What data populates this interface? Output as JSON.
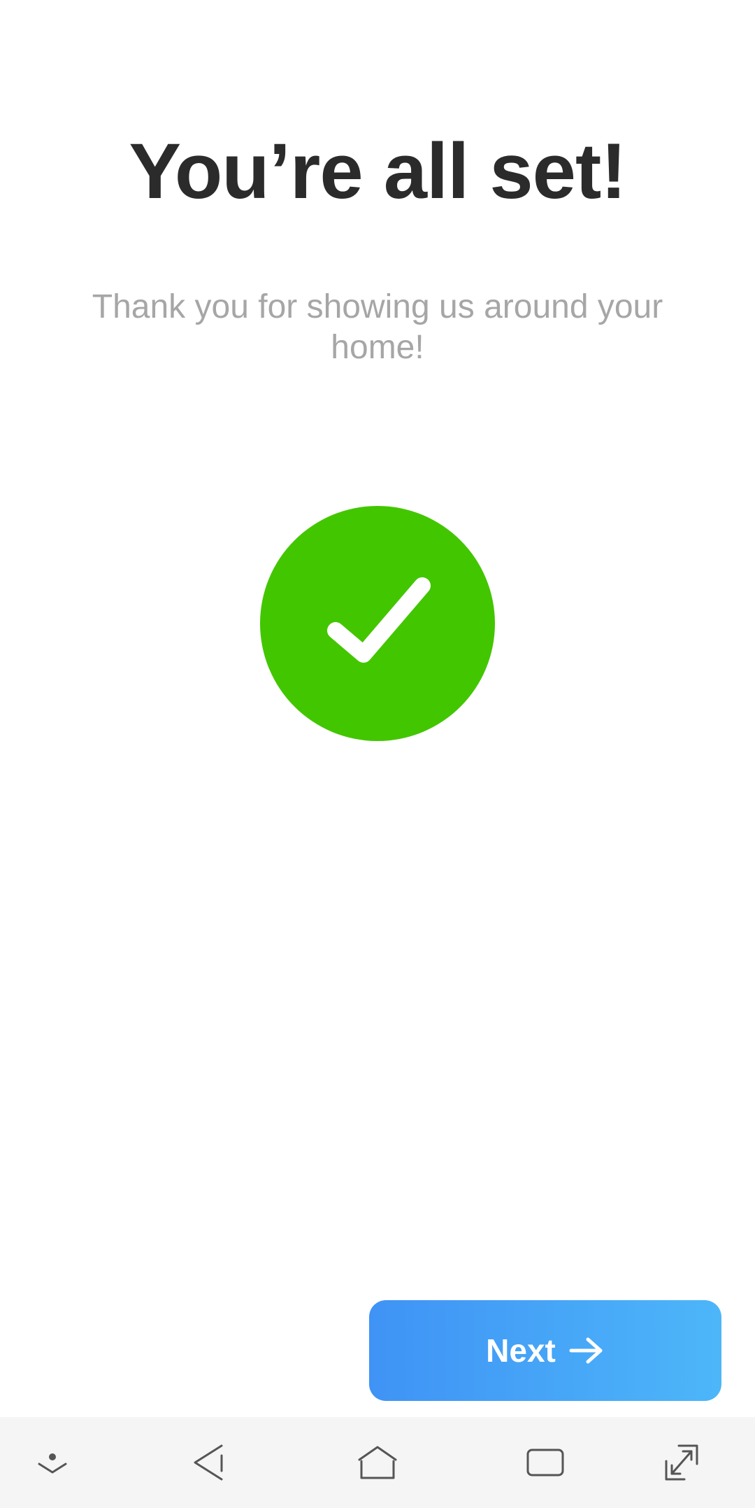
{
  "screen": {
    "title": "You’re all set!",
    "subtitle": "Thank you for showing us around your home!"
  },
  "success": {
    "icon": "checkmark-icon",
    "color": "#42c600"
  },
  "primary_button": {
    "label": "Next",
    "icon": "arrow-right-icon",
    "gradient_start": "#3f93f5",
    "gradient_end": "#4db6f9"
  },
  "navigation_bar": {
    "background": "#f5f5f5",
    "items": [
      {
        "name": "hide-keyboard",
        "icon": "chevron-down-dot-icon"
      },
      {
        "name": "back",
        "icon": "back-triangle-icon"
      },
      {
        "name": "home",
        "icon": "home-icon"
      },
      {
        "name": "recents",
        "icon": "recents-icon"
      },
      {
        "name": "expand",
        "icon": "expand-icon"
      }
    ]
  }
}
